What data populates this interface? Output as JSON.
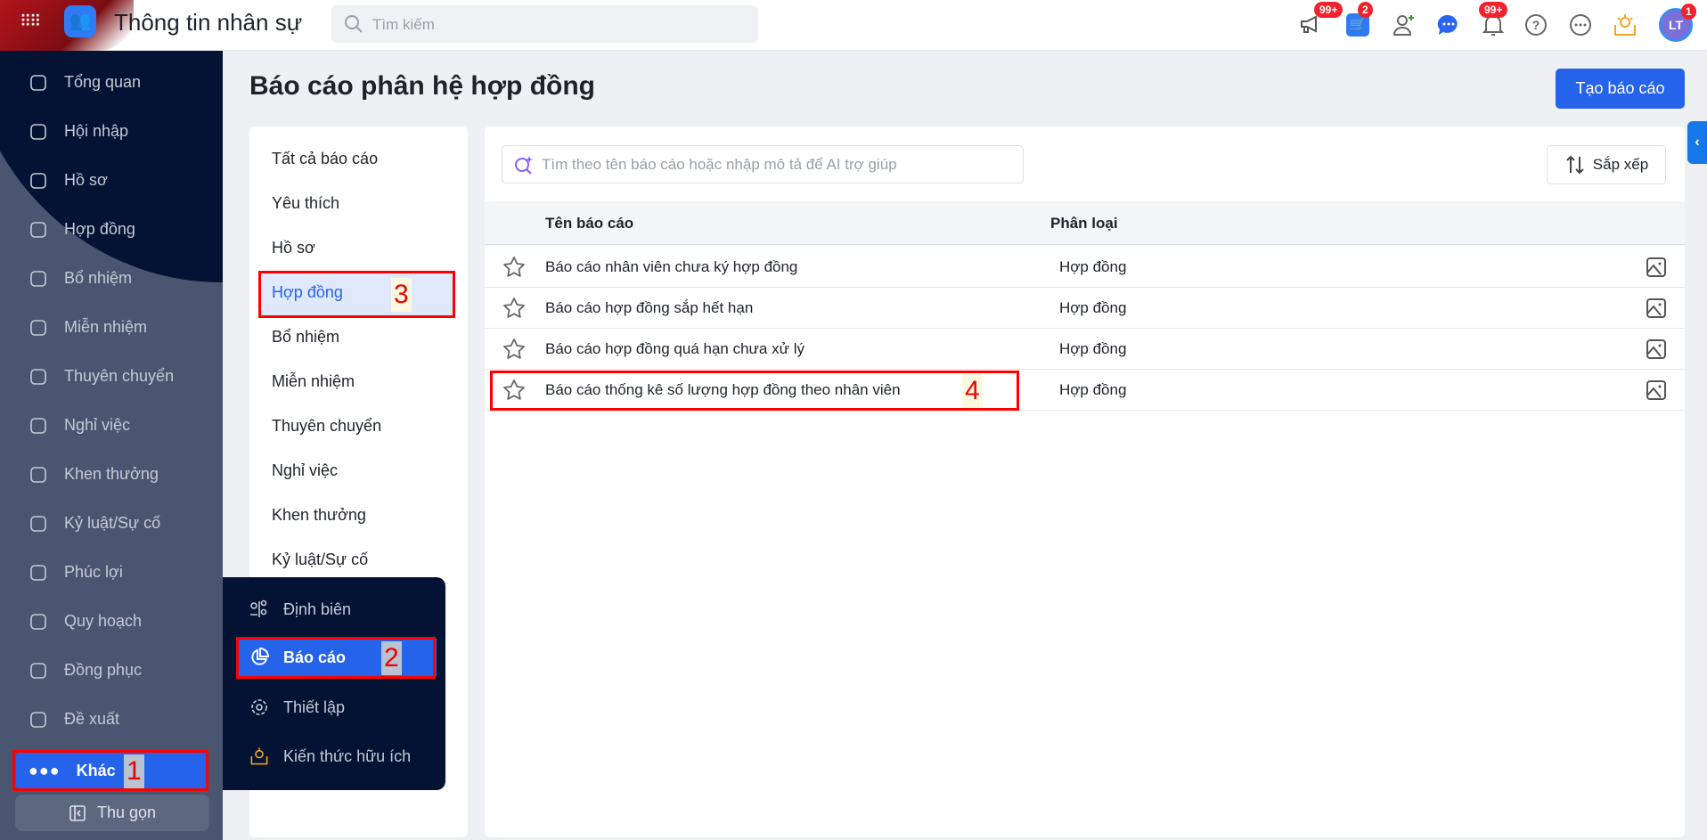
{
  "header": {
    "app_title": "Thông tin nhân sự",
    "search_placeholder": "Tìm kiếm",
    "badges": {
      "announcements": "99+",
      "cart": "2",
      "notifications": "99+",
      "avatar": "1"
    },
    "avatar_initials": "LT"
  },
  "sidebar": {
    "items": [
      "Tổng quan",
      "Hội nhập",
      "Hồ sơ",
      "Hợp đồng",
      "Bổ nhiệm",
      "Miễn nhiệm",
      "Thuyên chuyển",
      "Nghỉ việc",
      "Khen thưởng",
      "Kỷ luật/Sự cố",
      "Phúc lợi",
      "Quy hoạch",
      "Đồng phục",
      "Đề xuất"
    ],
    "more_label": "Khác",
    "collapse_label": "Thu gọn"
  },
  "flyout": {
    "items": [
      "Định biên",
      "Báo cáo",
      "Thiết lập",
      "Kiến thức hữu ích"
    ]
  },
  "page": {
    "title": "Báo cáo phân hệ hợp đồng",
    "create_button": "Tạo báo cáo"
  },
  "categories": [
    "Tất cả báo cáo",
    "Yêu thích",
    "Hồ sơ",
    "Hợp đồng",
    "Bổ nhiệm",
    "Miễn nhiệm",
    "Thuyên chuyển",
    "Nghỉ việc",
    "Khen thưởng",
    "Kỷ luật/Sự cố"
  ],
  "main": {
    "search_placeholder": "Tìm theo tên báo cáo hoặc nhập mô tả để AI trợ giúp",
    "sort_label": "Sắp xếp",
    "columns": [
      "Tên báo cáo",
      "Phân loại"
    ],
    "rows": [
      {
        "name": "Báo cáo nhân viên chưa ký hợp đồng",
        "category": "Hợp đồng"
      },
      {
        "name": "Báo cáo hợp đồng sắp hết hạn",
        "category": "Hợp đồng"
      },
      {
        "name": "Báo cáo hợp đồng quá hạn chưa xử lý",
        "category": "Hợp đồng"
      },
      {
        "name": "Báo cáo thống kê số lượng hợp đồng theo nhân viên",
        "category": "Hợp đồng"
      }
    ]
  },
  "annotations": [
    "1",
    "2",
    "3",
    "4"
  ],
  "colors": {
    "primary": "#2563eb",
    "sidebar_dark": "#041333",
    "sidebar_light": "#4a5670",
    "highlight": "#ff0000"
  }
}
